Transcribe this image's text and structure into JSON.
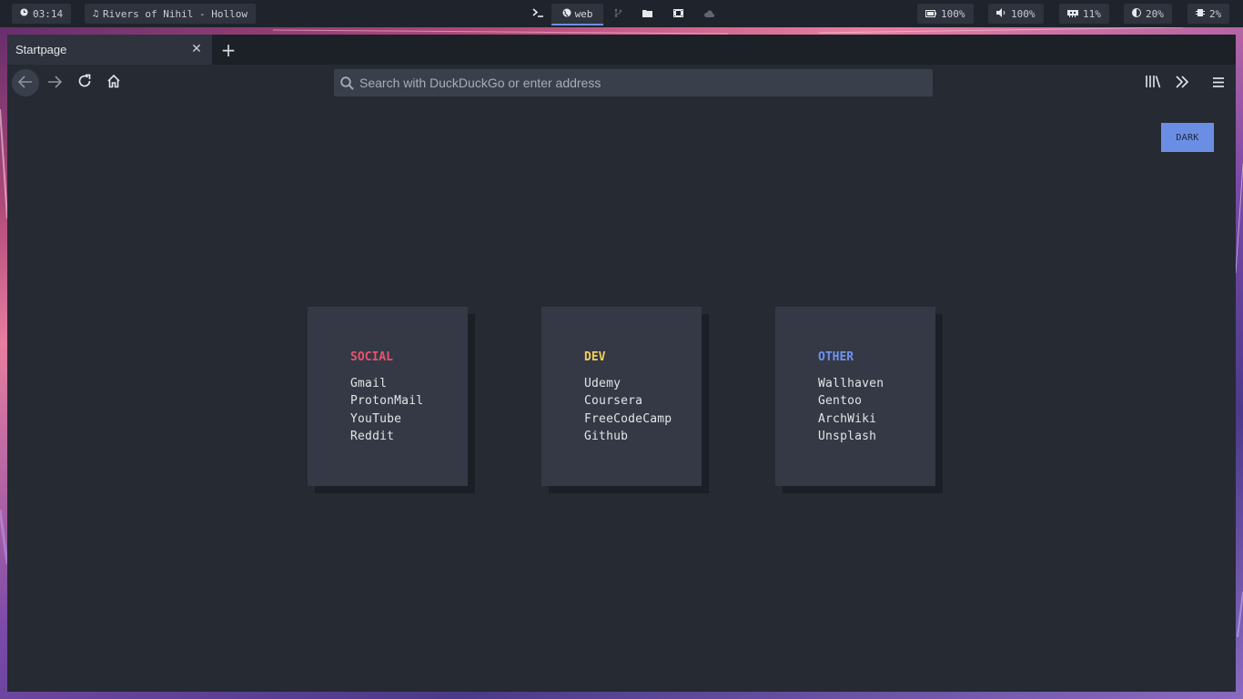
{
  "topbar": {
    "clock": {
      "icon": "clock-icon",
      "text": "03:14"
    },
    "music": {
      "icon": "music-note-icon",
      "text": "Rivers of Nihil - Hollow"
    },
    "workspaces": [
      {
        "icon": "terminal-icon",
        "label": ""
      },
      {
        "icon": "globe-icon",
        "label": "web"
      },
      {
        "icon": "git-branch-icon",
        "label": ""
      },
      {
        "icon": "folder-icon",
        "label": ""
      },
      {
        "icon": "film-icon",
        "label": ""
      },
      {
        "icon": "cloud-icon",
        "label": ""
      }
    ],
    "status": {
      "battery": {
        "icon": "battery-icon",
        "text": "100%"
      },
      "volume": {
        "icon": "volume-icon",
        "text": "100%"
      },
      "memory": {
        "icon": "memory-icon",
        "text": "11%"
      },
      "brightness": {
        "icon": "brightness-icon",
        "text": "20%"
      },
      "cpu": {
        "icon": "cpu-icon",
        "text": "2%"
      }
    }
  },
  "browser": {
    "tab": {
      "title": "Startpage"
    },
    "urlbar": {
      "placeholder": "Search with DuckDuckGo or enter address",
      "value": ""
    }
  },
  "page": {
    "theme_button": "DARK",
    "cards": [
      {
        "title": "SOCIAL",
        "color": "#e8536e",
        "links": [
          "Gmail",
          "ProtonMail",
          "YouTube",
          "Reddit"
        ]
      },
      {
        "title": "DEV",
        "color": "#f2cf5b",
        "links": [
          "Udemy",
          "Coursera",
          "FreeCodeCamp",
          "Github"
        ]
      },
      {
        "title": "OTHER",
        "color": "#6f93ee",
        "links": [
          "Wallhaven",
          "Gentoo",
          "ArchWiki",
          "Unsplash"
        ]
      }
    ]
  },
  "colors": {
    "accent": "#6b8ee5",
    "bar_bg": "#1f232b",
    "page_bg": "#252a33",
    "card_bg": "#343945"
  }
}
